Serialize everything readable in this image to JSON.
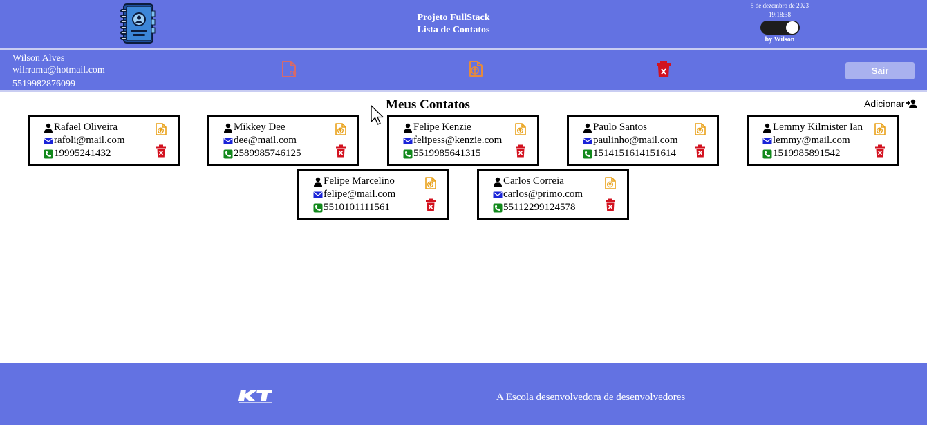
{
  "header": {
    "title_line1": "Projeto FullStack",
    "title_line2": "Lista de Contatos",
    "date": "5 de dezembro de 2023",
    "time": "19:18:38",
    "byline": "by Wilson",
    "logo_icon": "address-book-icon",
    "theme_toggle_on": true
  },
  "user": {
    "name": "Wilson Alves",
    "email": "wilrrama@hotmail.com",
    "phone": "5519982876099"
  },
  "toolbar": {
    "pdf_icon": "pdf-file-icon",
    "export_icon": "file-export-icon",
    "delete_icon": "trash-icon",
    "logout_label": "Sair"
  },
  "main": {
    "title": "Meus Contatos",
    "add_label": "Adicionar"
  },
  "contacts": [
    {
      "name": "Rafael Oliveira",
      "email": "rafoli@mail.com",
      "phone": "19995241432"
    },
    {
      "name": "Mikkey Dee",
      "email": "dee@mail.com",
      "phone": "2589985746125"
    },
    {
      "name": "Felipe Kenzie",
      "email": "felipess@kenzie.com",
      "phone": "5519985641315"
    },
    {
      "name": "Paulo Santos",
      "email": "paulinho@mail.com",
      "phone": "1514151614151614"
    },
    {
      "name": "Lemmy Kilmister Ian",
      "email": "lemmy@mail.com",
      "phone": "1519985891542"
    },
    {
      "name": "Felipe Marcelino",
      "email": "felipe@mail.com",
      "phone": "5510101111561"
    },
    {
      "name": "Carlos Correia",
      "email": "carlos@primo.com",
      "phone": "55112299124578"
    }
  ],
  "footer": {
    "logo_icon": "kenzie-logo-icon",
    "slogan": "A Escola desenvolvedora de desenvolvedores"
  },
  "colors": {
    "header_bg": "#6372e2",
    "user_icon": "#000000",
    "email_icon": "#1a24d8",
    "phone_icon": "#12891c",
    "edit_icon": "#e9a21a",
    "delete_icon": "#d3121f",
    "pdf_icon": "#d66a6a",
    "export_icon": "#e58a3d"
  }
}
